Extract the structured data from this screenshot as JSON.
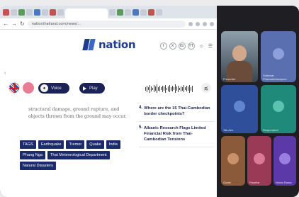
{
  "browser": {
    "url": "nationthailand.com/news/...",
    "brand_colors": {
      "primary": "#1f3b8f",
      "accent": "#3a67c9",
      "tag_bg": "#1b2a6b"
    }
  },
  "site": {
    "logo": "nation",
    "social_icons": [
      "f",
      "X",
      "IG",
      "YT"
    ],
    "header_icons": [
      "user-icon",
      "menu-icon"
    ]
  },
  "audio": {
    "voice_label": "Voice",
    "play_label": "Play"
  },
  "article": {
    "excerpt": "structural damage, ground rupture, and objects thrown from the ground may occur."
  },
  "tags": [
    "TAGS",
    "Earthquake",
    "Tremor",
    "Quake",
    "India",
    "Phang Nga",
    "Thai Meteorological Department",
    "Natural Disasters"
  ],
  "sidebar": [
    {
      "num": "4.",
      "text": "Where are the 15 Thai-Cambodian border checkpoints?"
    },
    {
      "num": "5.",
      "text": "Albanic Research Flags Limited Financial Risk from Thai-Cambodian Tensions"
    }
  ],
  "participants": [
    {
      "name": "Presenter",
      "color": "#6b7a86"
    },
    {
      "name": "Suthiwat Phanwatcharaporn",
      "color": "#4960a8"
    },
    {
      "name": "Tak Aim",
      "color": "#2f4f9a"
    },
    {
      "name": "Respondent",
      "color": "#1f8a7a"
    },
    {
      "name": "Guest",
      "color": "#8a5a3a"
    },
    {
      "name": "Panelist",
      "color": "#9a3a56"
    },
    {
      "name": "Nonta Rama",
      "color": "#5b3aa8"
    }
  ]
}
